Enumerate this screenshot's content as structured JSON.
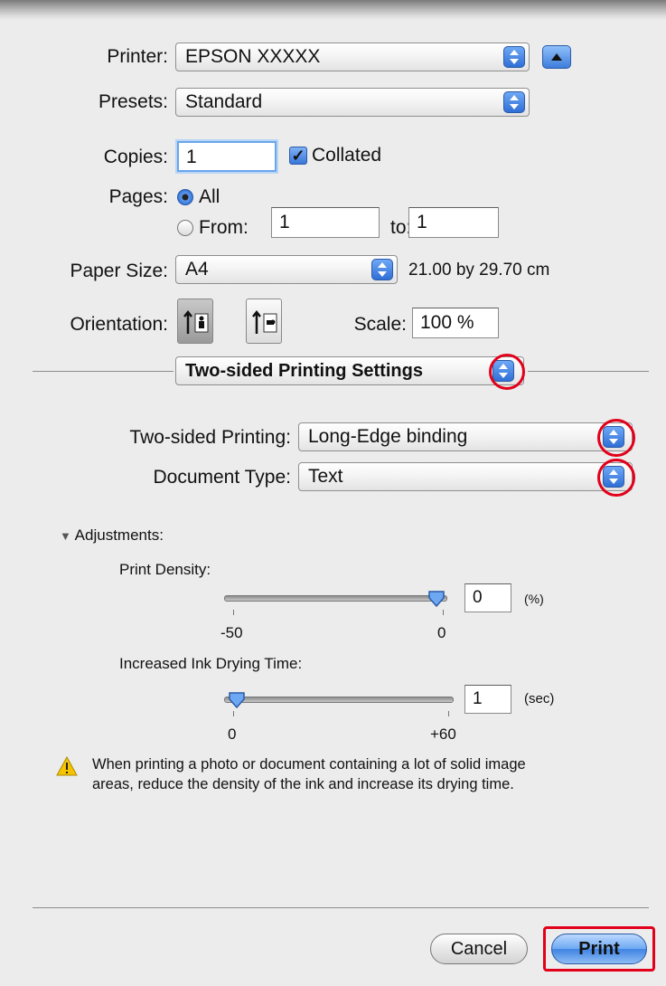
{
  "printer": {
    "label": "Printer:",
    "value": "EPSON XXXXX"
  },
  "presets": {
    "label": "Presets:",
    "value": "Standard"
  },
  "copies": {
    "label": "Copies:",
    "value": "1",
    "collated_label": "Collated"
  },
  "pages": {
    "label": "Pages:",
    "all_label": "All",
    "from_label": "From:",
    "from_value": "1",
    "to_label": "to:",
    "to_value": "1",
    "selected": "All"
  },
  "paper_size": {
    "label": "Paper Size:",
    "value": "A4",
    "dimensions": "21.00 by 29.70 cm"
  },
  "orientation": {
    "label": "Orientation:",
    "selected": "portrait"
  },
  "scale": {
    "label": "Scale:",
    "value": "100 %"
  },
  "panel_select": {
    "value": "Two-sided Printing Settings"
  },
  "two_sided": {
    "label": "Two-sided Printing:",
    "value": "Long-Edge binding"
  },
  "document_type": {
    "label": "Document Type:",
    "value": "Text"
  },
  "adjustments": {
    "label": "Adjustments:",
    "print_density": {
      "label": "Print Density:",
      "value": "0",
      "unit": "(%)",
      "min_label": "-50",
      "max_label": "0",
      "min": -50,
      "max": 0
    },
    "drying_time": {
      "label": "Increased Ink Drying Time:",
      "value": "1",
      "unit": "(sec)",
      "min_label": "0",
      "max_label": "+60",
      "min": 0,
      "max": 60
    }
  },
  "warning": {
    "line1": "When printing a photo or document containing a lot of solid image",
    "line2": "areas, reduce the density of the ink and increase its drying time."
  },
  "buttons": {
    "cancel": "Cancel",
    "print": "Print"
  },
  "colors": {
    "highlight": "#e2001a",
    "accent": "#3f83e2"
  }
}
